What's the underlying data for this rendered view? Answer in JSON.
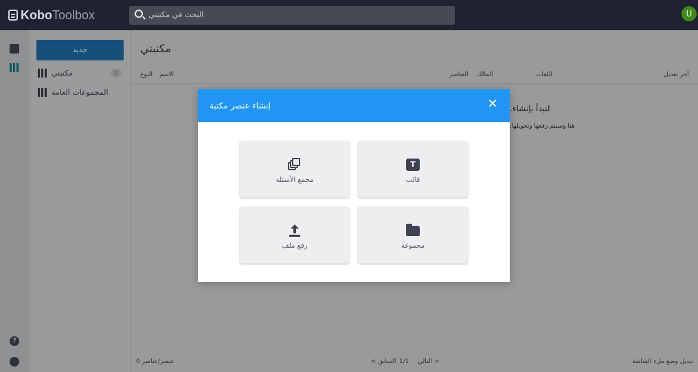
{
  "app": {
    "logo_bold": "Kobo",
    "logo_light": "Toolbox",
    "avatar_letter": "U"
  },
  "search": {
    "placeholder": "البحث في مكتبتي"
  },
  "sidebar": {
    "new_label": "جديد",
    "items": [
      {
        "label": "مكتبتي",
        "count": "0"
      },
      {
        "label": "المجموعات العامة"
      }
    ]
  },
  "rail": {
    "help_glyph": "?"
  },
  "main": {
    "title": "مكتبتي",
    "columns": {
      "type": "النوع",
      "name": "الاسم",
      "elements": "العناصر",
      "owner": "المالك",
      "languages": "اللغات",
      "last_modified": "آخر تعديل"
    },
    "empty_title": ".لنبدأ بإنشاء",
    "empty_sub": ".هنا وسيتم رفعها وتحويلها"
  },
  "footer": {
    "count": "0 عنصر/عناصر",
    "prev": "السابق",
    "page": "1/1",
    "next": "التالي",
    "fullscreen": "تبديل وضع ملء الشاشة"
  },
  "modal": {
    "title": "إنشاء عنصر مكتبة",
    "close": "✕",
    "tiles": {
      "question_bank": "مجمع الأسئلة",
      "template": "قالب",
      "template_glyph": "T",
      "upload": "رفع ملف",
      "collection": "مجموعة"
    }
  },
  "colors": {
    "topbar": "#1f2230",
    "accent": "#2095f3",
    "new_button": "#14507a",
    "avatar": "#3e8a1b"
  }
}
